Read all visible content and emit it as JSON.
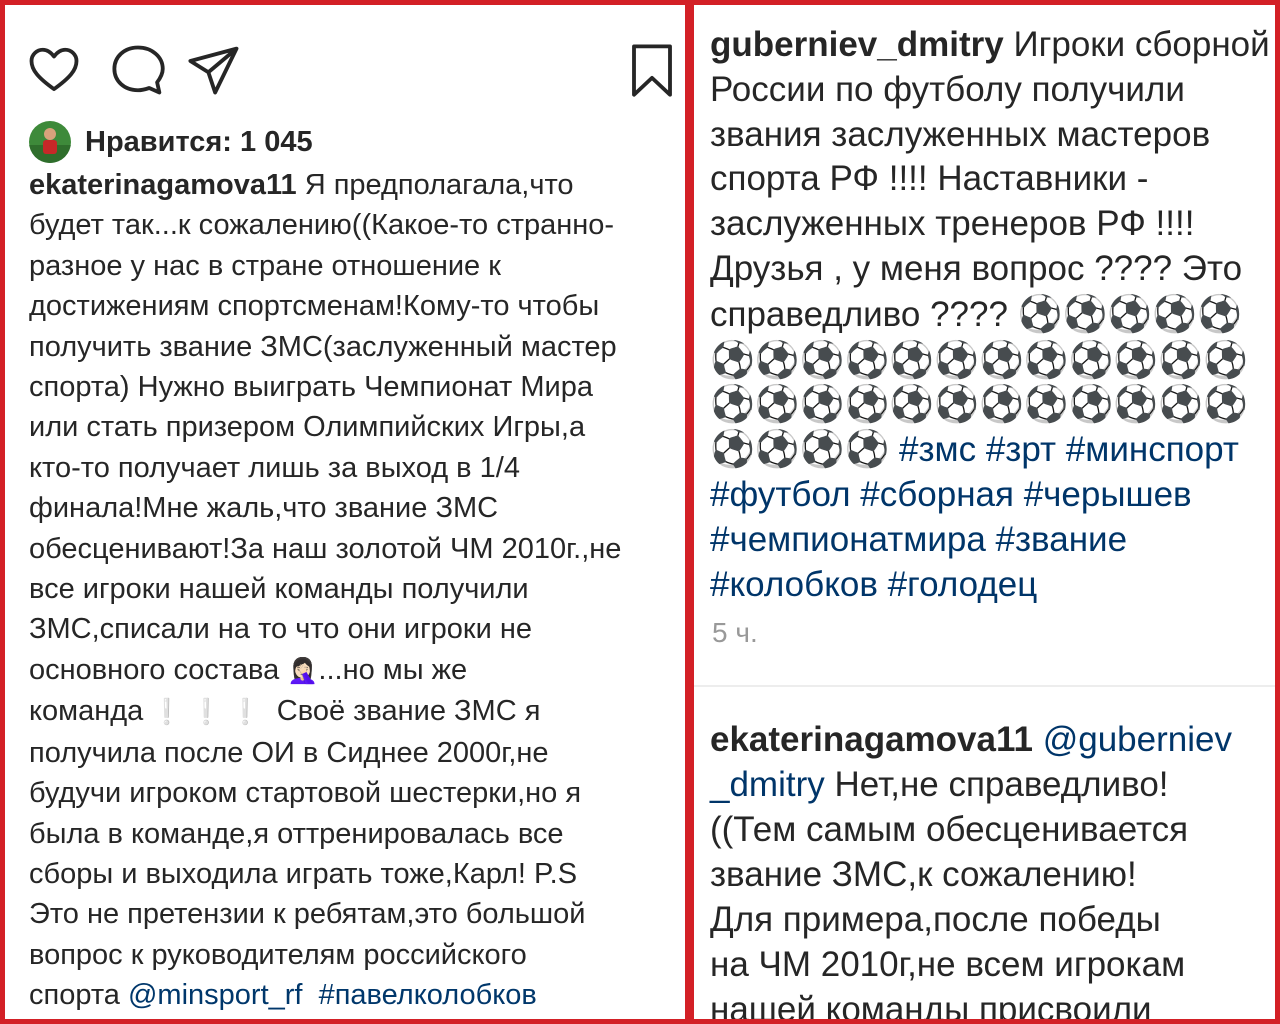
{
  "left_post": {
    "icons": [
      "heart-icon",
      "comment-icon",
      "share-icon",
      "bookmark-icon"
    ],
    "likes_label": "Нравится: 1 045",
    "username": "ekaterinagamova11",
    "caption_lines": [
      "Я предполагала,что",
      "будет так...к сожалению((Какое-то странно-",
      "разное у нас в стране отношение к",
      "достижениям спортсменам!Кому-то чтобы",
      "получить звание ЗМС(заслуженный мастер",
      "спорта) Нужно выиграть Чемпионат Мира",
      "или стать призером Олимпийских Игры,а",
      "кто-то получает лишь за выход в 1/4",
      "финала!Мне жаль,что звание ЗМС",
      "обесценивают!За наш золотой ЧМ 2010г.,не",
      "все игроки нашей команды получили",
      "ЗМС,списали на то что они игроки не"
    ],
    "line13_text": "основного состава",
    "line13_emoji": "🤦🏻‍♀",
    "line13_after": "...но мы же",
    "line14_text": "команда",
    "line14_emoji": "❕❕❕",
    "line14_after": "Своё звание ЗМС я",
    "caption_lines_2": [
      "получила после ОИ в Сиднее 2000г,не",
      "будучи игроком стартовой шестерки,но я",
      "была в команде,я оттренировалась все",
      "сборы и выходила играть тоже,Карл! P.S",
      "Это не претензии к ребятам,это большой",
      "вопрос к руководителям российского"
    ],
    "last_line_text": "спорта",
    "mention": "@minsport_rf",
    "hashtag": "#павелколобков"
  },
  "right_post": {
    "username": "guberniev_dmitry",
    "caption_first": "Игроки сборной",
    "caption_lines": [
      "России по футболу получили",
      "звания заслуженных мастеров",
      "спорта РФ !!!! Наставники -",
      "заслуженных тренеров РФ !!!!",
      "Друзья , у меня вопрос ???? Это"
    ],
    "caption_last_text": "справедливо ????",
    "balls_line1": "⚽⚽⚽⚽⚽",
    "balls_line2": "⚽⚽⚽⚽⚽⚽⚽⚽⚽⚽⚽⚽",
    "balls_line3": "⚽⚽⚽⚽⚽⚽⚽⚽⚽⚽⚽⚽",
    "balls_line4": "⚽⚽⚽⚽",
    "hashtags_line1": "#змс #зрт #минспорт",
    "hashtags_line2": "#футбол #сборная #черышев",
    "hashtags_line3": "#чемпионатмира #звание",
    "hashtags_line4": "#колобков #голодец",
    "time": "5 ч.",
    "reply": {
      "username": "ekaterinagamova11",
      "mention_part1": "@guberniev",
      "mention_part2": "_dmitry",
      "text_first": "Нет,не справедливо!",
      "lines": [
        "((Тем самым обесценивается",
        "звание ЗМС,к сожалению!",
        "Для примера,после победы",
        "на ЧМ 2010г,не всем игрокам",
        "нашей команды присвоили"
      ]
    }
  },
  "colors": {
    "border": "#d32026",
    "hashtag": "#00376b",
    "muted": "#999999"
  }
}
